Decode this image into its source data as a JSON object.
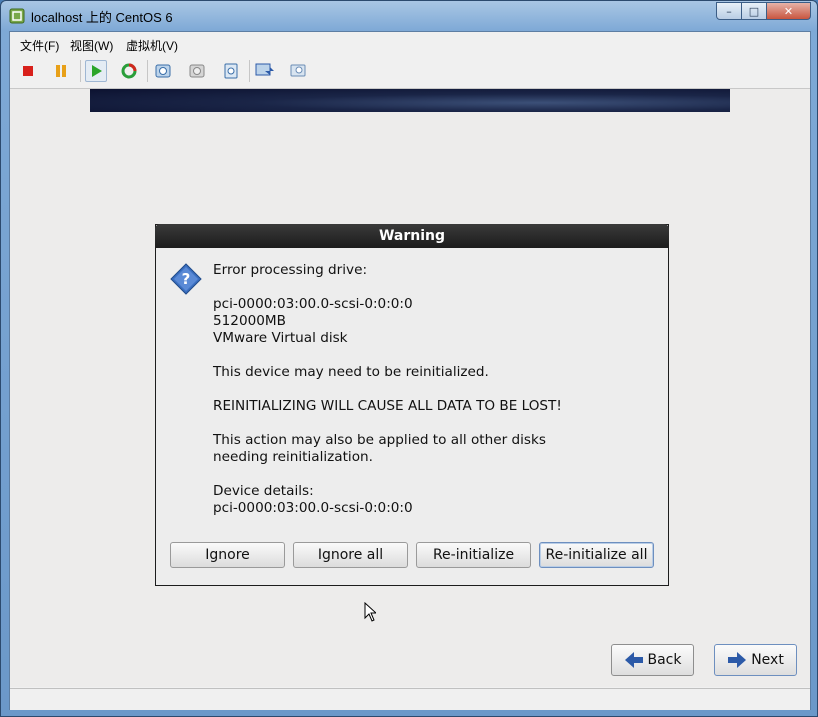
{
  "window": {
    "title": "localhost 上的 CentOS 6"
  },
  "menu": {
    "file": "文件(F)",
    "view": "视图(W)",
    "vm": "虚拟机(V)"
  },
  "toolbar": {
    "icons": [
      "stop-icon",
      "pause-icon",
      "play-icon",
      "reset-icon",
      "snapshot-icon",
      "revert-snapshot-icon",
      "manage-snapshots-icon",
      "console-view-icon",
      "vm-settings-icon"
    ]
  },
  "dialog": {
    "title": "Warning",
    "lines": [
      "Error processing drive:",
      "",
      "pci-0000:03:00.0-scsi-0:0:0:0",
      "512000MB",
      "VMware Virtual disk",
      "",
      "This device may need to be reinitialized.",
      "",
      "REINITIALIZING WILL CAUSE ALL DATA TO BE LOST!",
      "",
      "This action may also be applied to all other disks",
      "needing reinitialization.",
      "",
      "Device details:",
      "pci-0000:03:00.0-scsi-0:0:0:0"
    ],
    "buttons": {
      "ignore": "Ignore",
      "ignore_all": "Ignore all",
      "reinitialize": "Re-initialize",
      "reinitialize_all": "Re-initialize all"
    }
  },
  "nav": {
    "back": "Back",
    "next": "Next"
  },
  "colors": {
    "banner": "#1a2547",
    "dialog_title_bg": "#1c1c1c",
    "arrow_blue": "#2c5aa8"
  }
}
